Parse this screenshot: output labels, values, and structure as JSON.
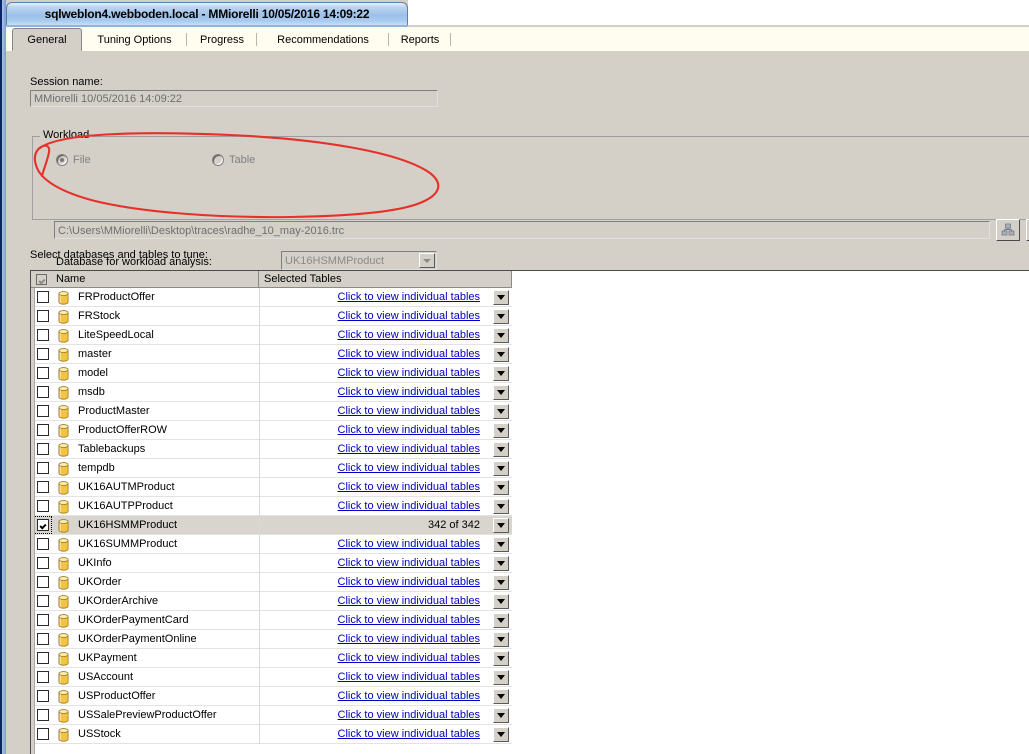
{
  "window": {
    "title": "sqlweblon4.webboden.local - MMiorelli 10/05/2016 14:09:22"
  },
  "tabs": [
    {
      "label": "General",
      "active": true
    },
    {
      "label": "Tuning Options",
      "active": false
    },
    {
      "label": "Progress",
      "active": false
    },
    {
      "label": "Recommendations",
      "active": false
    },
    {
      "label": "Reports",
      "active": false
    }
  ],
  "general": {
    "session_label": "Session name:",
    "session_value": "MMiorelli 10/05/2016 14:09:22",
    "workload": {
      "group_title": "Workload",
      "file_radio_label": "File",
      "table_radio_label": "Table",
      "file_selected": true,
      "path_value": "C:\\Users\\MMiorelli\\Desktop\\traces\\radhe_10_may-2016.trc",
      "db_for_analysis_label": "Database for workload analysis:",
      "db_for_analysis_value": "UK16HSMMProduct",
      "browse_icon": "connection-icon",
      "browse_icon_2": "table-icon"
    },
    "select_label": "Select databases and tables to tune:",
    "grid": {
      "columns": [
        "Name",
        "Selected Tables"
      ],
      "link_text": "Click to view individual tables",
      "header_checkbox_state": "indeterminate",
      "rows": [
        {
          "name": "FRProductOffer",
          "checked": false,
          "selected": false,
          "tables": "Click to view individual tables",
          "is_link": true
        },
        {
          "name": "FRStock",
          "checked": false,
          "selected": false,
          "tables": "Click to view individual tables",
          "is_link": true
        },
        {
          "name": "LiteSpeedLocal",
          "checked": false,
          "selected": false,
          "tables": "Click to view individual tables",
          "is_link": true
        },
        {
          "name": "master",
          "checked": false,
          "selected": false,
          "tables": "Click to view individual tables",
          "is_link": true
        },
        {
          "name": "model",
          "checked": false,
          "selected": false,
          "tables": "Click to view individual tables",
          "is_link": true
        },
        {
          "name": "msdb",
          "checked": false,
          "selected": false,
          "tables": "Click to view individual tables",
          "is_link": true
        },
        {
          "name": "ProductMaster",
          "checked": false,
          "selected": false,
          "tables": "Click to view individual tables",
          "is_link": true
        },
        {
          "name": "ProductOfferROW",
          "checked": false,
          "selected": false,
          "tables": "Click to view individual tables",
          "is_link": true
        },
        {
          "name": "Tablebackups",
          "checked": false,
          "selected": false,
          "tables": "Click to view individual tables",
          "is_link": true
        },
        {
          "name": "tempdb",
          "checked": false,
          "selected": false,
          "tables": "Click to view individual tables",
          "is_link": true
        },
        {
          "name": "UK16AUTMProduct",
          "checked": false,
          "selected": false,
          "tables": "Click to view individual tables",
          "is_link": true
        },
        {
          "name": "UK16AUTPProduct",
          "checked": false,
          "selected": false,
          "tables": "Click to view individual tables",
          "is_link": true
        },
        {
          "name": "UK16HSMMProduct",
          "checked": true,
          "selected": true,
          "tables": "342 of 342",
          "is_link": false
        },
        {
          "name": "UK16SUMMProduct",
          "checked": false,
          "selected": false,
          "tables": "Click to view individual tables",
          "is_link": true
        },
        {
          "name": "UKInfo",
          "checked": false,
          "selected": false,
          "tables": "Click to view individual tables",
          "is_link": true
        },
        {
          "name": "UKOrder",
          "checked": false,
          "selected": false,
          "tables": "Click to view individual tables",
          "is_link": true
        },
        {
          "name": "UKOrderArchive",
          "checked": false,
          "selected": false,
          "tables": "Click to view individual tables",
          "is_link": true
        },
        {
          "name": "UKOrderPaymentCard",
          "checked": false,
          "selected": false,
          "tables": "Click to view individual tables",
          "is_link": true
        },
        {
          "name": "UKOrderPaymentOnline",
          "checked": false,
          "selected": false,
          "tables": "Click to view individual tables",
          "is_link": true
        },
        {
          "name": "UKPayment",
          "checked": false,
          "selected": false,
          "tables": "Click to view individual tables",
          "is_link": true
        },
        {
          "name": "USAccount",
          "checked": false,
          "selected": false,
          "tables": "Click to view individual tables",
          "is_link": true
        },
        {
          "name": "USProductOffer",
          "checked": false,
          "selected": false,
          "tables": "Click to view individual tables",
          "is_link": true
        },
        {
          "name": "USSalePreviewProductOffer",
          "checked": false,
          "selected": false,
          "tables": "Click to view individual tables",
          "is_link": true
        },
        {
          "name": "USStock",
          "checked": false,
          "selected": false,
          "tables": "Click to view individual tables",
          "is_link": true
        }
      ]
    }
  },
  "annotation": {
    "type": "hand-drawn-ellipse",
    "color": "#e8302a"
  }
}
